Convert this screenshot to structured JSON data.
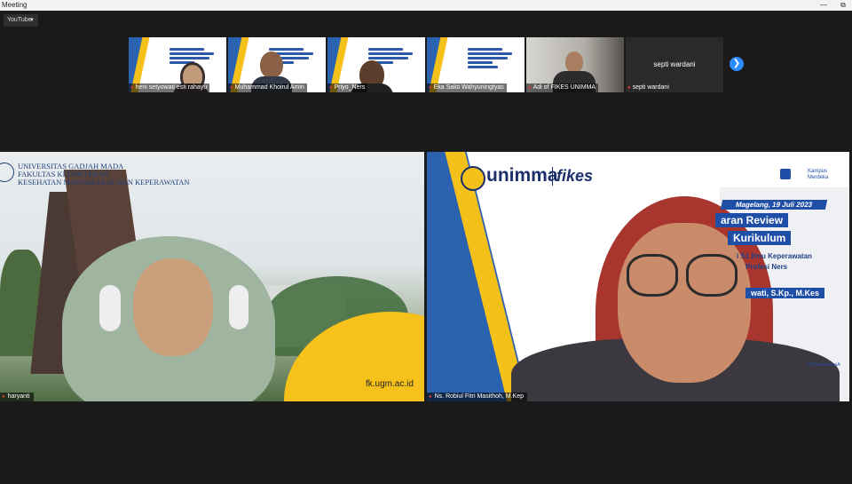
{
  "window": {
    "title": "Meeting",
    "minimize_icon": "minimize-icon",
    "restore_icon": "restore-icon"
  },
  "youtube_menu": {
    "label": "YouTube",
    "icon": "caret-down-icon"
  },
  "gallery": [
    {
      "name": "heni setyowati esti rahayu"
    },
    {
      "name": "Muhammad Khoirul Amin"
    },
    {
      "name": "Priyo_Ners"
    },
    {
      "name": "Eka Sakti Wahyuningtyas"
    },
    {
      "name": "Adi of FIKES UNIMMA"
    },
    {
      "name": "septi wardani",
      "display": "septi wardani"
    }
  ],
  "next_page_icon": "chevron-right-icon",
  "main": {
    "left": {
      "participant": "haryanti",
      "header_line1": "UNIVERSITAS GADJAH MADA",
      "header_line2": "FAKULTAS KEDOKTERAN",
      "header_line3": "KESEHATAN MASYARAKAT DAN KEPERAWATAN",
      "url": "fk.ugm.ac.id"
    },
    "right": {
      "participant": "Ns. Robiul Fitri Masithoh, M.Kep",
      "brand1": "unimma",
      "brand2": "fikes",
      "date": "Magelang, 19 Juli 2023",
      "banner1": "aran Review",
      "banner2": "Kurikulum",
      "line1": "i S1 Ilmu Keperawatan",
      "line2": "Profesi Ners",
      "speaker": "wati, S.Kp., M.Kes",
      "hashtag": "#FikesUnimmaA",
      "kampus": "Kampus Merdeka"
    }
  },
  "colors": {
    "accent_blue": "#2d8cff",
    "mic_muted": "#e23b3b",
    "unimma_blue": "#1f4ea6",
    "unimma_yellow": "#f4c01a"
  }
}
